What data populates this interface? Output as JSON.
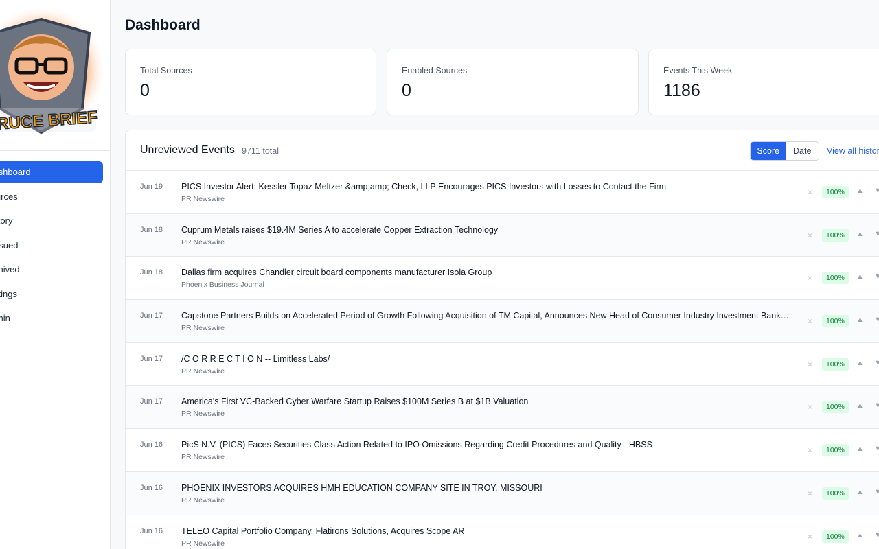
{
  "sidebar": {
    "logo_text": "BRUCE BRIEF",
    "nav": [
      {
        "label": "Dashboard",
        "active": true
      },
      {
        "label": "Sources",
        "active": false
      },
      {
        "label": "History",
        "active": false
      },
      {
        "label": "Pursued",
        "active": false
      },
      {
        "label": "Archived",
        "active": false
      },
      {
        "label": "Settings",
        "active": false
      },
      {
        "label": "Admin",
        "active": false
      }
    ]
  },
  "page": {
    "title": "Dashboard"
  },
  "stats": [
    {
      "label": "Total Sources",
      "value": "0"
    },
    {
      "label": "Enabled Sources",
      "value": "0"
    },
    {
      "label": "Events This Week",
      "value": "1186"
    }
  ],
  "events": {
    "title": "Unreviewed Events",
    "count": "9711 total",
    "sort": {
      "score": "Score",
      "date": "Date",
      "selected": "Score"
    },
    "view_all": "View all history",
    "dismiss_glyph": "×",
    "up_glyph": "▲",
    "down_glyph": "▼",
    "rows": [
      {
        "date": "Jun 19",
        "title": "PICS Investor Alert: Kessler Topaz Meltzer &amp;amp; Check, LLP Encourages PICS Investors with Losses to Contact the Firm",
        "source": "PR Newswire",
        "score": "100%"
      },
      {
        "date": "Jun 18",
        "title": "Cuprum Metals raises $19.4M Series A to accelerate Copper Extraction Technology",
        "source": "PR Newswire",
        "score": "100%"
      },
      {
        "date": "Jun 18",
        "title": "Dallas firm acquires Chandler circuit board components manufacturer Isola Group",
        "source": "Phoenix Business Journal",
        "score": "100%"
      },
      {
        "date": "Jun 17",
        "title": "Capstone Partners Builds on Accelerated Period of Growth Following Acquisition of TM Capital, Announces New Head of Consumer Industry Investment Banking",
        "source": "PR Newswire",
        "score": "100%"
      },
      {
        "date": "Jun 17",
        "title": "/C O R R E C T I O N -- Limitless Labs/",
        "source": "PR Newswire",
        "score": "100%"
      },
      {
        "date": "Jun 17",
        "title": "America's First VC-Backed Cyber Warfare Startup Raises $100M Series B at $1B Valuation",
        "source": "PR Newswire",
        "score": "100%"
      },
      {
        "date": "Jun 16",
        "title": "PicS N.V. (PICS) Faces Securities Class Action Related to IPO Omissions Regarding Credit Procedures and Quality - HBSS",
        "source": "PR Newswire",
        "score": "100%"
      },
      {
        "date": "Jun 16",
        "title": "PHOENIX INVESTORS ACQUIRES HMH EDUCATION COMPANY SITE IN TROY, MISSOURI",
        "source": "PR Newswire",
        "score": "100%"
      },
      {
        "date": "Jun 16",
        "title": "TELEO Capital Portfolio Company, Flatirons Solutions, Acquires Scope AR",
        "source": "PR Newswire",
        "score": "100%"
      }
    ]
  },
  "colors": {
    "accent": "#2563eb",
    "score_bg": "#dcfce7",
    "score_fg": "#15803d"
  }
}
